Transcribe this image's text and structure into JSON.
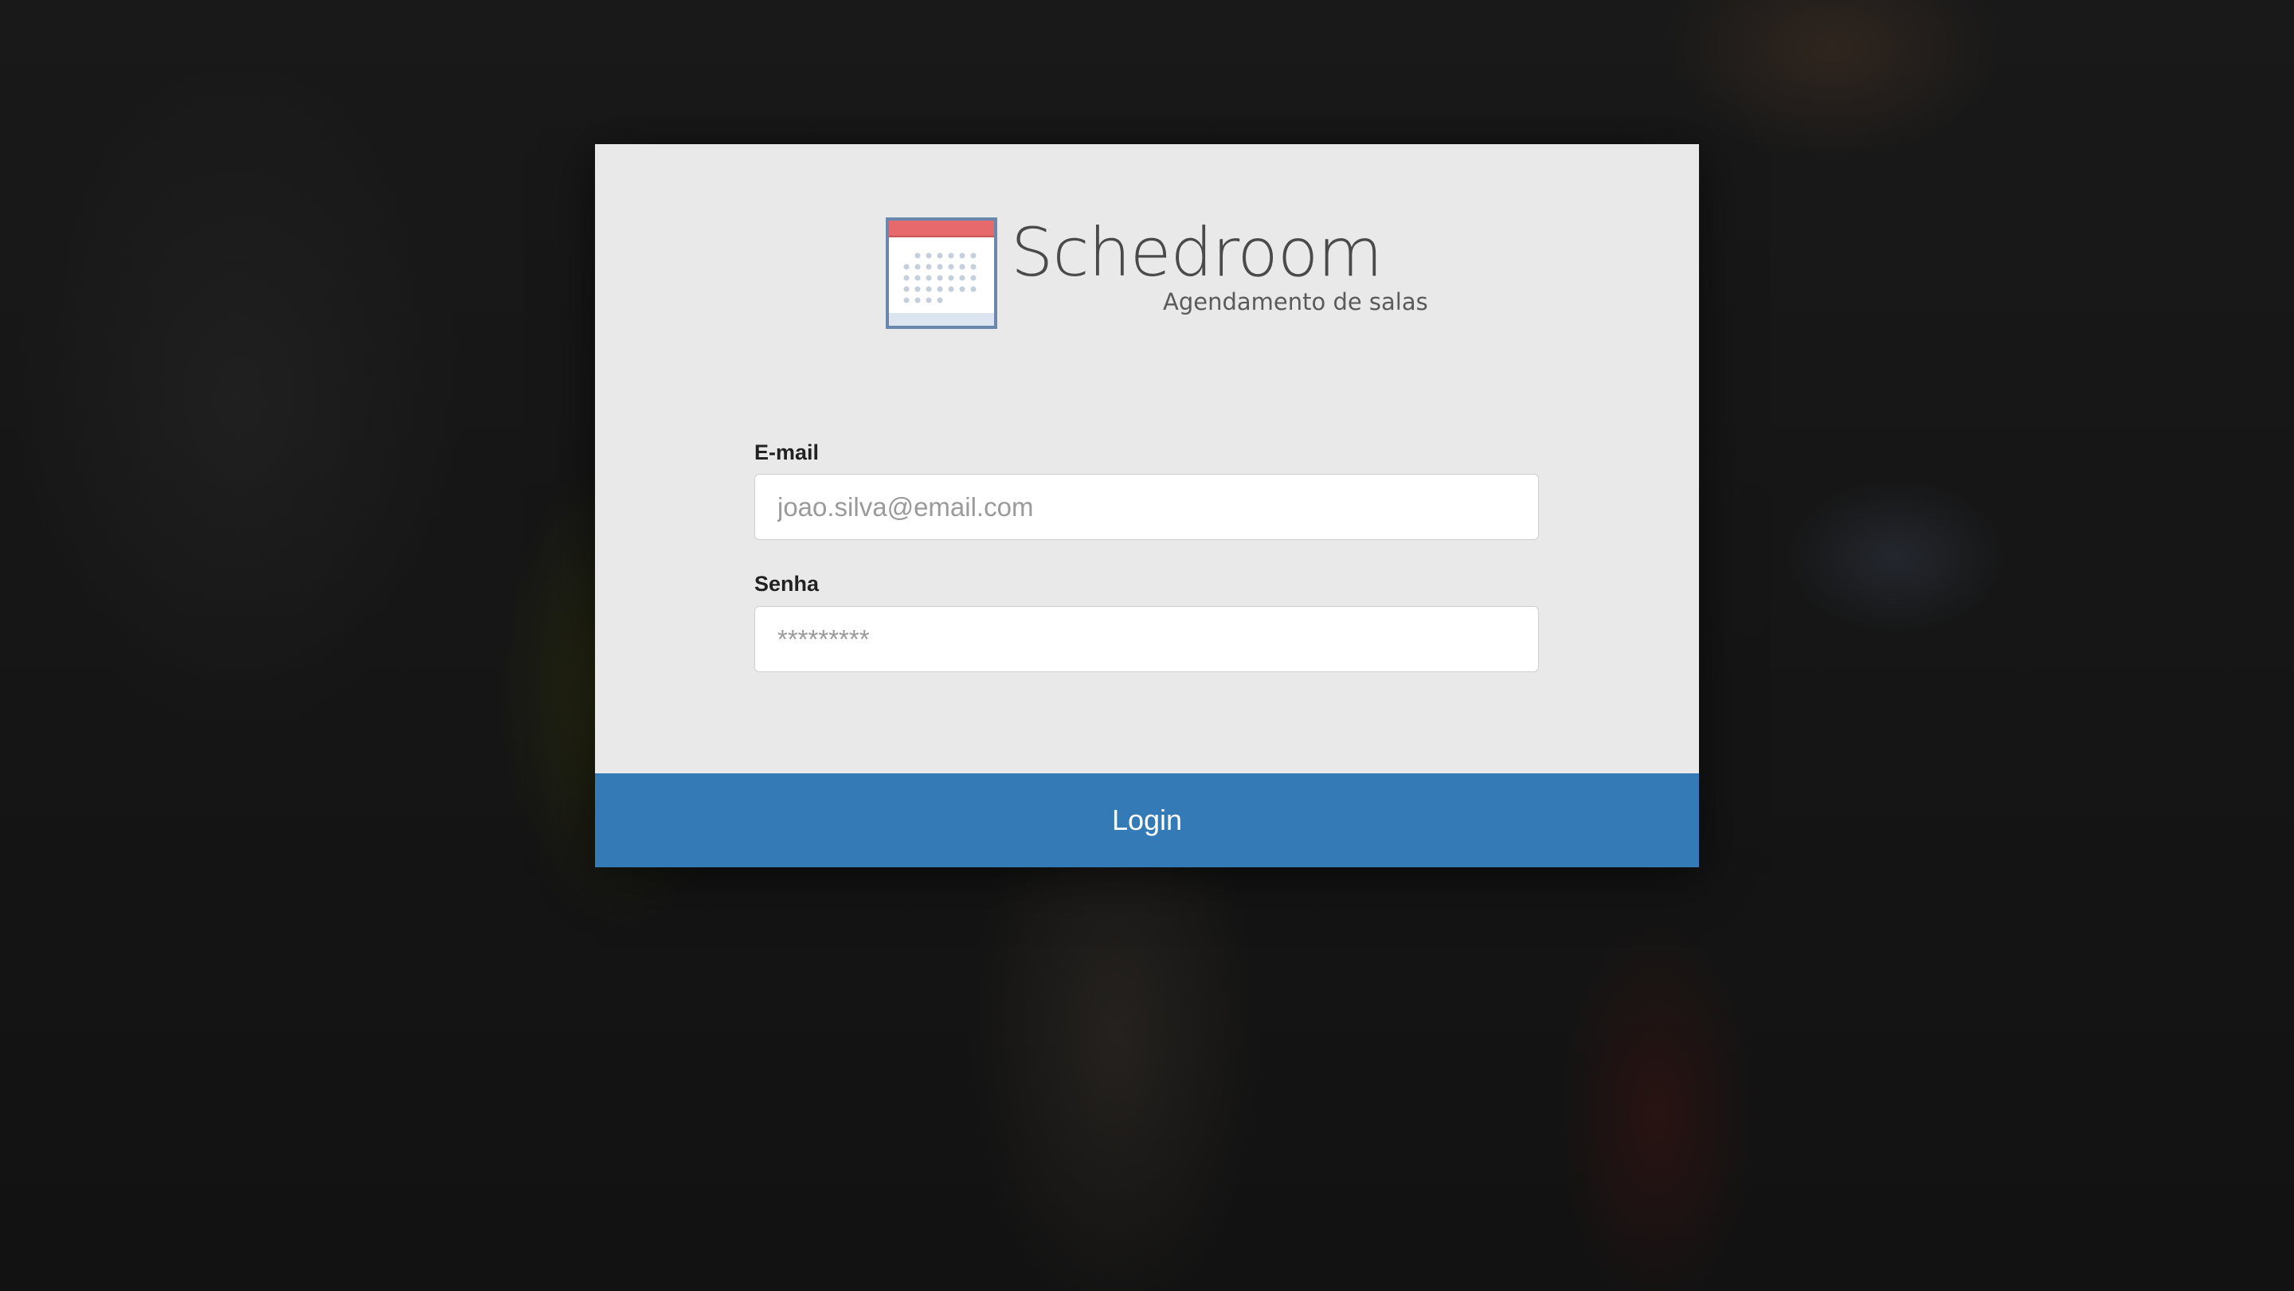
{
  "app": {
    "name": "Schedroom",
    "tagline": "Agendamento de salas"
  },
  "form": {
    "email_label": "E-mail",
    "email_placeholder": "joao.silva@email.com",
    "email_value": "",
    "password_label": "Senha",
    "password_placeholder": "*********",
    "password_value": "",
    "login_label": "Login"
  },
  "colors": {
    "primary": "#337ab7",
    "modal_background": "#e9e9e9",
    "calendar_accent": "#e8696b",
    "calendar_border": "#5f7fa3"
  },
  "icons": {
    "logo": "calendar-icon"
  }
}
